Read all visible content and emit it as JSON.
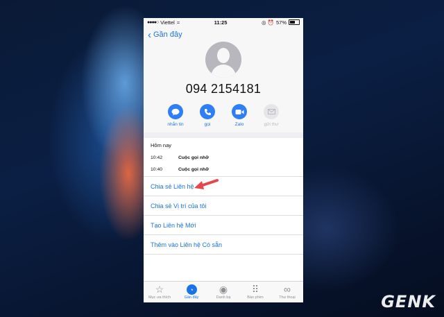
{
  "status_bar": {
    "signal": "●●●●○",
    "carrier": "Viettel",
    "wifi": "≈",
    "time": "11:25",
    "icons": "◎ ⏰",
    "battery": "57%"
  },
  "nav": {
    "back_label": "Gần đây"
  },
  "contact": {
    "number": "094 2154181"
  },
  "actions": [
    {
      "label": "nhắn tin",
      "icon": "message-bubble-icon",
      "glyph": "💬"
    },
    {
      "label": "gọi",
      "icon": "phone-icon",
      "glyph": "✆"
    },
    {
      "label": "Zalo",
      "icon": "video-icon",
      "glyph": "■"
    },
    {
      "label": "gửi thư",
      "icon": "mail-icon",
      "glyph": "✉"
    }
  ],
  "recents": {
    "title": "Hôm nay",
    "calls": [
      {
        "time": "10:42",
        "type": "Cuộc gọi nhỡ"
      },
      {
        "time": "10:40",
        "type": "Cuộc gọi nhỡ"
      }
    ]
  },
  "menu": [
    {
      "label": "Chia sẻ Liên hệ"
    },
    {
      "label": "Chia sẻ Vị trí của tôi"
    },
    {
      "label": "Tạo Liên hệ Mới"
    },
    {
      "label": "Thêm vào Liên hệ Có sẵn"
    }
  ],
  "tabs": [
    {
      "label": "Mục ưa thích",
      "glyph": "☆",
      "icon": "star-icon"
    },
    {
      "label": "Gần đây",
      "glyph": "◔",
      "icon": "clock-icon",
      "active": true
    },
    {
      "label": "Danh bạ",
      "glyph": "◉",
      "icon": "contact-icon"
    },
    {
      "label": "Bàn phím",
      "glyph": "⠿",
      "icon": "keypad-icon"
    },
    {
      "label": "Thư thoại",
      "glyph": "∞",
      "icon": "voicemail-icon"
    }
  ],
  "watermark": "GENK",
  "colors": {
    "accent": "#1a73e8",
    "action_button": "#2f7ef5",
    "arrow": "#e8464a"
  }
}
